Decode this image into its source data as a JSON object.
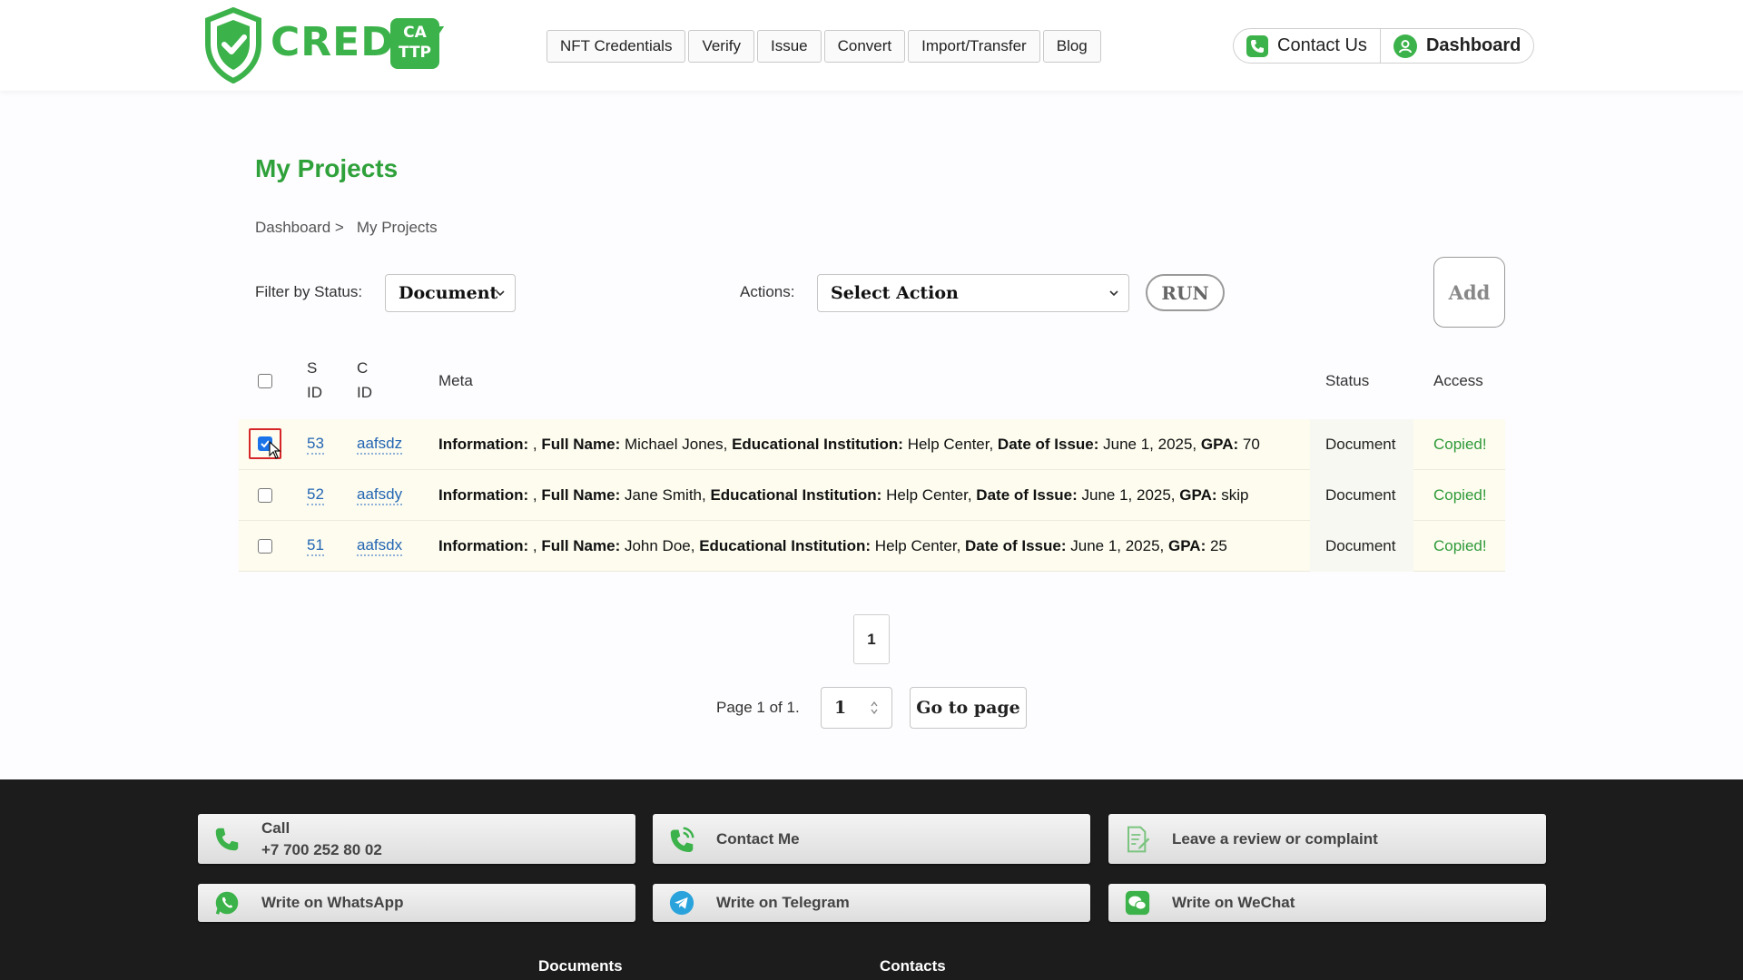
{
  "header": {
    "logo_text": "CREDLY",
    "logo_badge_top": "CA",
    "logo_badge_bottom": "TTP",
    "nav": [
      "NFT Credentials",
      "Verify",
      "Issue",
      "Convert",
      "Import/Transfer",
      "Blog"
    ],
    "contact_label": "Contact Us",
    "dashboard_label": "Dashboard"
  },
  "page": {
    "title": "My Projects",
    "breadcrumb": {
      "home": "Dashboard >",
      "current": "My Projects"
    }
  },
  "toolbar": {
    "filter_label": "Filter by Status:",
    "filter_value": "Document",
    "actions_label": "Actions:",
    "actions_value": "Select Action",
    "run_label": "RUN",
    "add_label": "Add"
  },
  "table": {
    "headers": {
      "sid_1": "S",
      "sid_2": "ID",
      "cid_1": "C",
      "cid_2": "ID",
      "meta": "Meta",
      "status": "Status",
      "access": "Access"
    },
    "rows": [
      {
        "checked": true,
        "sid": "53",
        "cid": "aafsdz",
        "meta": {
          "k1": "Information:",
          "v1": " , ",
          "k2": "Full Name:",
          "v2": " Michael Jones, ",
          "k3": "Educational Institution:",
          "v3": " Help Center, ",
          "k4": "Date of Issue:",
          "v4": " June 1, 2025, ",
          "k5": "GPA:",
          "v5": " 70"
        },
        "status": "Document",
        "access": "Copied!"
      },
      {
        "checked": false,
        "sid": "52",
        "cid": "aafsdy",
        "meta": {
          "k1": "Information:",
          "v1": " , ",
          "k2": "Full Name:",
          "v2": " Jane Smith, ",
          "k3": "Educational Institution:",
          "v3": " Help Center, ",
          "k4": "Date of Issue:",
          "v4": " June 1, 2025, ",
          "k5": "GPA:",
          "v5": " skip"
        },
        "status": "Document",
        "access": "Copied!"
      },
      {
        "checked": false,
        "sid": "51",
        "cid": "aafsdx",
        "meta": {
          "k1": "Information:",
          "v1": " , ",
          "k2": "Full Name:",
          "v2": " John Doe, ",
          "k3": "Educational Institution:",
          "v3": " Help Center, ",
          "k4": "Date of Issue:",
          "v4": " June 1, 2025, ",
          "k5": "GPA:",
          "v5": " 25"
        },
        "status": "Document",
        "access": "Copied!"
      }
    ]
  },
  "pagination": {
    "current_page": "1",
    "info": "Page 1 of 1.",
    "input_value": "1",
    "go_label": "Go to page"
  },
  "footer": {
    "call_label": "Call",
    "call_number": "+7 700 252 80 02",
    "contact_me": "Contact Me",
    "review": "Leave a review or complaint",
    "whatsapp": "Write on WhatsApp",
    "telegram": "Write on Telegram",
    "wechat": "Write on WeChat",
    "col_documents": "Documents",
    "col_contacts": "Contacts"
  },
  "colors": {
    "brand_green": "#3cb24a",
    "title_green": "#2fa13a",
    "link_blue": "#2466b3",
    "row_bg": "#fdfcef",
    "footer_bg": "#1c1c1c"
  }
}
